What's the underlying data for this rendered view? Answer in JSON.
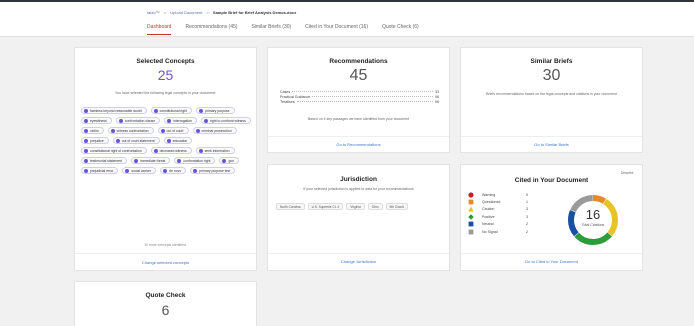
{
  "breadcrumb": {
    "items": [
      "tablo™",
      ">",
      "Upload Document",
      ">",
      "Sample Brief for Brief Analysis Demos.docx"
    ]
  },
  "tabs": [
    {
      "label": "Dashboard",
      "active": true
    },
    {
      "label": "Recommendations (45)",
      "active": false
    },
    {
      "label": "Similar Briefs (30)",
      "active": false
    },
    {
      "label": "Cited in Your Document (16)",
      "active": false
    },
    {
      "label": "Quote Check (6)",
      "active": false
    }
  ],
  "selected_concepts": {
    "title": "Selected Concepts",
    "count": "25",
    "subtitle": "You have selected the following legal concepts in your document:",
    "chips": [
      "faimless beyond reasonable doubt",
      "constitutional right",
      "primary purpose",
      "eyewitness",
      "confrontation clause",
      "interrogation",
      "right to confront witness",
      "victim",
      "witness confrontation",
      "out of court",
      "criminal prosecution",
      "prejudice",
      "out of court statement",
      "education",
      "constitutional right of confrontation",
      "deceased witness",
      "seek information",
      "testimonial statement",
      "immediate threat",
      "confrontation right",
      "gun",
      "prejudicial error",
      "social worker",
      "de novo",
      "primary purpose test"
    ],
    "more_text": "10 more concepts identified.",
    "link": "Change selected concepts"
  },
  "recommendations": {
    "title": "Recommendations",
    "count": "45",
    "rows": [
      {
        "label": "Cases",
        "value": "33"
      },
      {
        "label": "Practical Guidance",
        "value": "06"
      },
      {
        "label": "Treatises",
        "value": "06"
      }
    ],
    "note": "Based on 4 key passages we have identified from your document",
    "link": "Go to Recommendations"
  },
  "jurisdiction": {
    "title": "Jurisdiction",
    "subtitle": "If your selected jurisdiction is applied to data for your recommendations",
    "chips": [
      "North Carolina",
      "U.S. Supreme Ct. 4",
      "Virginia",
      "Ohio",
      "5th Circuit"
    ],
    "link": "Change Jurisdiction"
  },
  "similar_briefs": {
    "title": "Similar Briefs",
    "count": "30",
    "subtitle": "Briefs recommendations based on the legal concepts and citations in your document",
    "link": "Go to Similar Briefs"
  },
  "cited": {
    "title": "Cited in Your Document",
    "describe_out": "Describe",
    "legend": [
      {
        "label": "Warning",
        "value": "0",
        "icon": "red-circle-icon",
        "color": "#c0262d"
      },
      {
        "label": "Questioned",
        "value": "1",
        "icon": "orange-square-icon",
        "color": "#e8892f"
      },
      {
        "label": "Caution",
        "value": "3",
        "icon": "yellow-triangle-icon",
        "color": "#e8c321"
      },
      {
        "label": "Positive",
        "value": "3",
        "icon": "green-diamond-icon",
        "color": "#2c9b3a"
      },
      {
        "label": "Neutral",
        "value": "2",
        "icon": "blue-square-icon",
        "color": "#1b4fa3"
      },
      {
        "label": "No Signal",
        "value": "2",
        "icon": "grey-square-icon",
        "color": "#9a9a9a"
      }
    ],
    "total": "16",
    "total_label": "Total Citations",
    "link": "Go to Cited in Your Document"
  },
  "quote_check": {
    "title": "Quote Check",
    "count": "6"
  }
}
